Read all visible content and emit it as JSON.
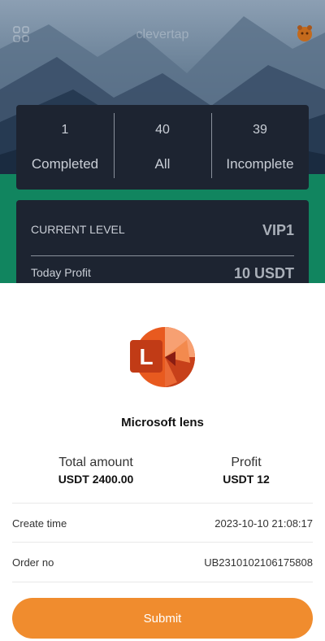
{
  "header": {
    "brand": "clevertap"
  },
  "stats": [
    {
      "value": "1",
      "label": "Completed"
    },
    {
      "value": "40",
      "label": "All"
    },
    {
      "value": "39",
      "label": "Incomplete"
    }
  ],
  "level": {
    "current_label": "CURRENT LEVEL",
    "current_value": "VIP1",
    "profit_label": "Today Profit",
    "profit_value": "10 USDT"
  },
  "sheet": {
    "app_logo_icon": "microsoft-lens-logo",
    "app_logo_letter": "L",
    "app_name": "Microsoft lens",
    "total_label": "Total amount",
    "total_value": "USDT 2400.00",
    "profit_label": "Profit",
    "profit_value": "USDT 12",
    "create_time_label": "Create time",
    "create_time_value": "2023-10-10 21:08:17",
    "order_no_label": "Order no",
    "order_no_value": "UB2310102106175808",
    "submit_label": "Submit"
  },
  "colors": {
    "accent": "#f08c2e",
    "card_bg": "#1d2431",
    "green_band": "#11855f"
  }
}
